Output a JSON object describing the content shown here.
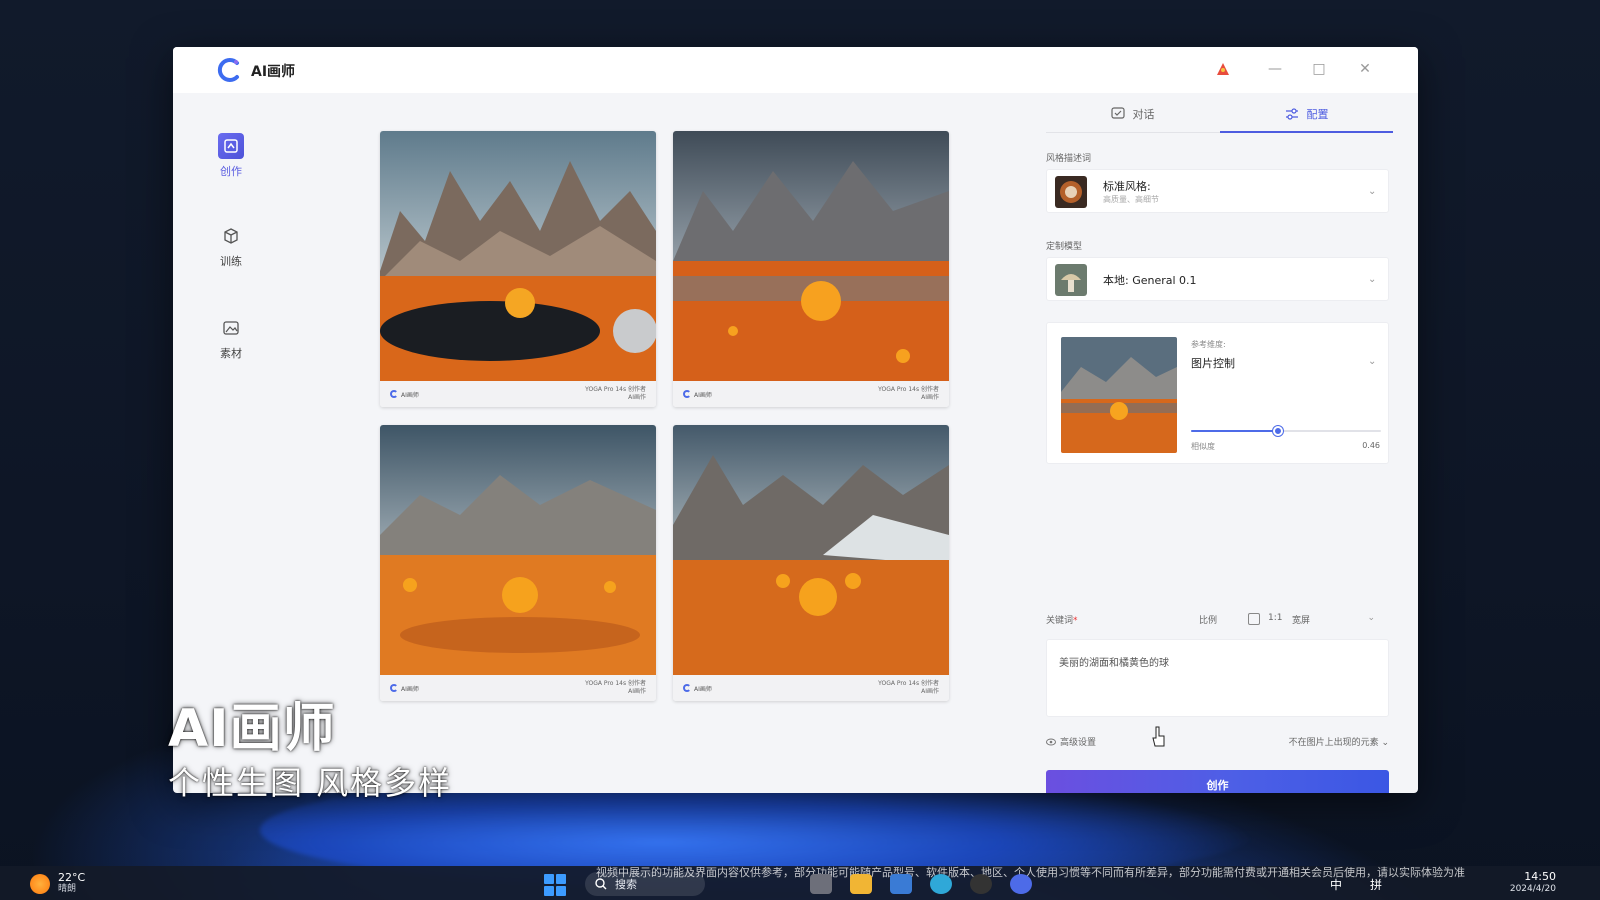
{
  "app": {
    "title": "AI画师",
    "window_controls": [
      "—",
      "□",
      "✕"
    ]
  },
  "sidebar": {
    "items": [
      {
        "label": "创作",
        "icon": "create-icon",
        "active": true
      },
      {
        "label": "训练",
        "icon": "cube-icon",
        "active": false
      },
      {
        "label": "素材",
        "icon": "gallery-icon",
        "active": false
      }
    ]
  },
  "gallery": {
    "brand": "AI画师",
    "watermark_line1": "YOGA Pro 14s 创作者",
    "watermark_line2": "AI画作"
  },
  "panel": {
    "tabs": [
      {
        "label": "对话",
        "icon": "chat-icon",
        "active": false
      },
      {
        "label": "配置",
        "icon": "settings-icon",
        "active": true
      }
    ],
    "style_section_label": "风格描述词",
    "style_title": "标准风格:",
    "style_sub": "高质量、高细节",
    "model_section_label": "定制模型",
    "model_value": "本地: General 0.1",
    "ref_label": "参考维度:",
    "ref_value": "图片控制",
    "similarity_label": "相似度",
    "similarity_value": "0.46",
    "similarity": 0.46,
    "keyword_label": "关键词",
    "keyword_required": "*",
    "ratio_label": "比例",
    "ratio_value": "1:1",
    "ratio_mode": "宽屏",
    "prompt_text": "美丽的湖面和橘黄色的球",
    "advanced_label": "高级设置",
    "negative_label": "不在图片上出现的元素",
    "create_button": "创作"
  },
  "caption": {
    "title": "AI画师",
    "subtitle": "个性生图 风格多样"
  },
  "taskbar": {
    "temperature": "22°C",
    "weather": "晴朗",
    "search_label": "搜索",
    "notice": "视频中展示的功能及界面内容仅供参考，部分功能可能随产品型号、软件版本、地区、个人使用习惯等不同而有所差异，部分功能需付费或开通相关会员后使用，请以实际体验为准",
    "ime_1": "中",
    "ime_2": "拼",
    "time": "14:50",
    "date": "2024/4/20"
  },
  "colors": {
    "accent": "#4d5ce0",
    "button_start": "#6b4fe0",
    "button_end": "#3b57e4",
    "orange": "#ff8a1c"
  }
}
